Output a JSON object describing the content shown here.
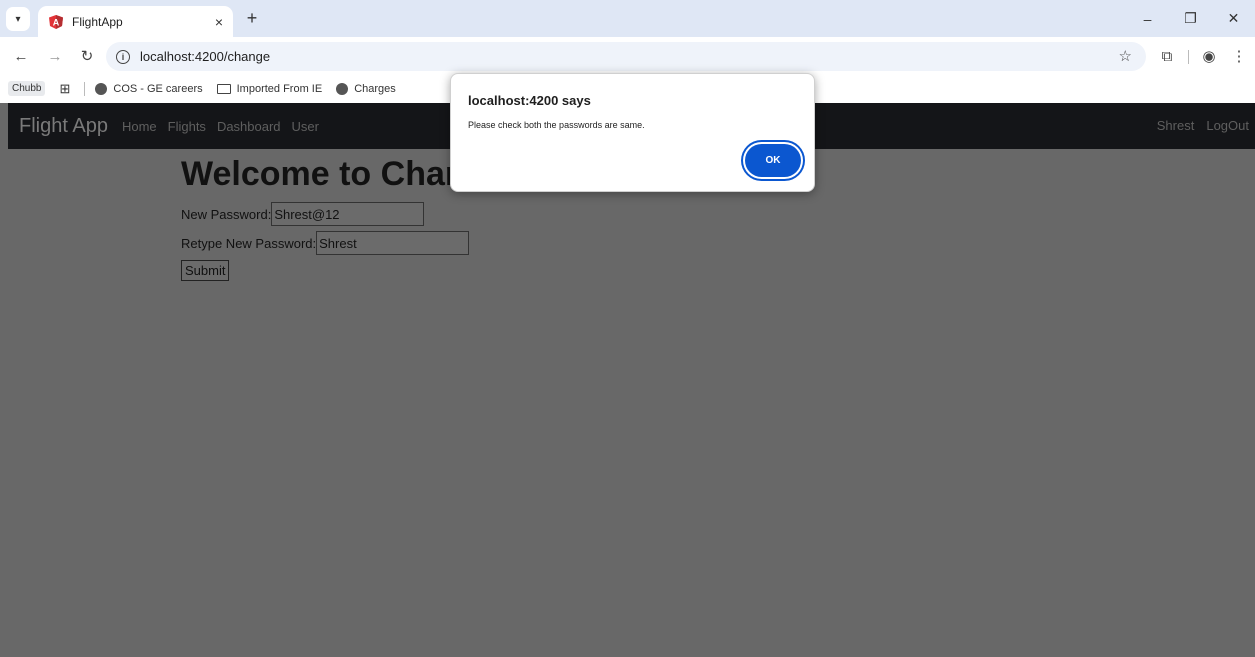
{
  "browser": {
    "tab_title": "FlightApp",
    "tab_close": "×",
    "new_tab": "+",
    "url": "localhost:4200/change",
    "window_controls": [
      "–",
      "❐",
      "✕"
    ]
  },
  "bookmarks": {
    "items": [
      "Chubb",
      "COS - GE careers",
      "Imported From IE",
      "Charges"
    ]
  },
  "navbar": {
    "brand": "Flight App",
    "links": [
      "Home",
      "Flights",
      "Dashboard",
      "User"
    ],
    "right": [
      "Shrest",
      "LogOut"
    ]
  },
  "page": {
    "heading": "Welcome to Chang",
    "new_password_label": "New Password:",
    "new_password_value": "Shrest@12",
    "retype_label": "Retype New Password:",
    "retype_value": "Shrest",
    "submit_label": "Submit"
  },
  "dialog": {
    "title": "localhost:4200 says",
    "message": "Please check both the passwords are same.",
    "ok_label": "OK"
  },
  "colors": {
    "accent": "#0b57d0",
    "navbar": "#141518",
    "overlay": "#686868"
  }
}
